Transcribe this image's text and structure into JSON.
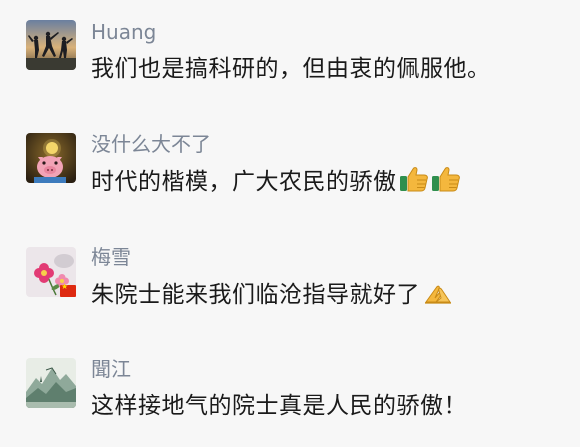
{
  "comments": [
    {
      "name": "Huang",
      "text": "我们也是搞科研的，但由衷的佩服他。",
      "avatar_icon": "silhouette-sunset-avatar",
      "emojis": []
    },
    {
      "name": "没什么大不了",
      "text": "时代的楷模，广大农民的骄傲",
      "avatar_icon": "cartoon-pig-avatar",
      "emojis": [
        "thumbs-up-icon",
        "thumbs-up-icon"
      ]
    },
    {
      "name": "梅雪",
      "text": "朱院士能来我们临沧指导就好了",
      "avatar_icon": "flowers-avatar",
      "badge_icon": "china-flag-icon",
      "emojis": [
        "folded-hands-icon"
      ]
    },
    {
      "name": "聞江",
      "text": "这样接地气的院士真是人民的骄傲！",
      "avatar_icon": "mountain-landscape-avatar",
      "emojis": []
    }
  ],
  "colors": {
    "background": "#f7f7f7",
    "name": "#7c8696",
    "text": "#1a1a1a"
  }
}
